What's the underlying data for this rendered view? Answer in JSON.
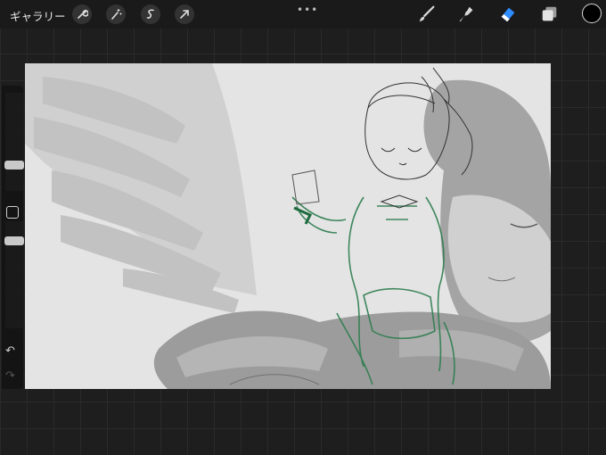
{
  "topbar": {
    "gallery_label": "ギャラリー",
    "more_icon": "•••",
    "left_tools": [
      "wrench-icon",
      "magic-wand-icon",
      "selection-icon",
      "transform-arrow-icon"
    ],
    "right_tools": [
      "brush-icon",
      "smudge-icon",
      "eraser-icon",
      "layers-icon"
    ],
    "active_tool": "eraser",
    "active_color": "#0a0a0a",
    "accent": "#2f8cff"
  },
  "sidebar": {
    "undo": "↶",
    "redo": "↷"
  }
}
